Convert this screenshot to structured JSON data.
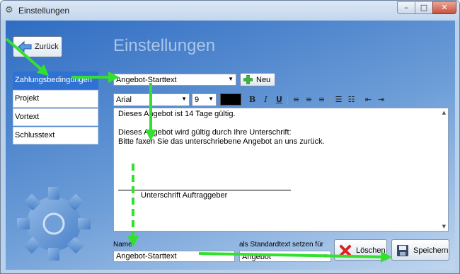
{
  "window": {
    "title": "Einstellungen",
    "minimize_glyph": "–",
    "maximize_glyph": "□",
    "close_glyph": "✕"
  },
  "back_label": "Zurück",
  "page_title": "Einstellungen",
  "nav": {
    "items": [
      "Zahlungsbedingungen",
      "Projekt",
      "Vortext",
      "Schlusstext"
    ],
    "active_index": 0
  },
  "template_select": {
    "value": "Angebot-Starttext"
  },
  "new_label": "Neu",
  "toolbar": {
    "font": "Arial",
    "size": "9",
    "bold": "B",
    "italic": "I",
    "underline": "U"
  },
  "editor": {
    "lines": [
      "Dieses Angebot ist 14 Tage gültig.",
      "Dieses Angebot wird gültig durch Ihre Unterschrift:",
      "Bitte faxen Sie das unterschriebene Angebot an uns zurück."
    ],
    "signature_caption": "Unterschrift Auftraggeber"
  },
  "name_field": {
    "label": "Name",
    "value": "Angebot-Starttext"
  },
  "default_field": {
    "label": "als Standardtext setzen für",
    "value": "Angebot"
  },
  "delete_label": "Löschen",
  "save_label": "Speichern",
  "colors": {
    "accent": "#2f72d1",
    "annotation_arrow": "#33e02f",
    "text_color_swatch": "#000000"
  },
  "icons": [
    "settings-icon",
    "back-arrow-icon",
    "plus-icon",
    "delete-icon",
    "save-icon",
    "gear-icon"
  ]
}
